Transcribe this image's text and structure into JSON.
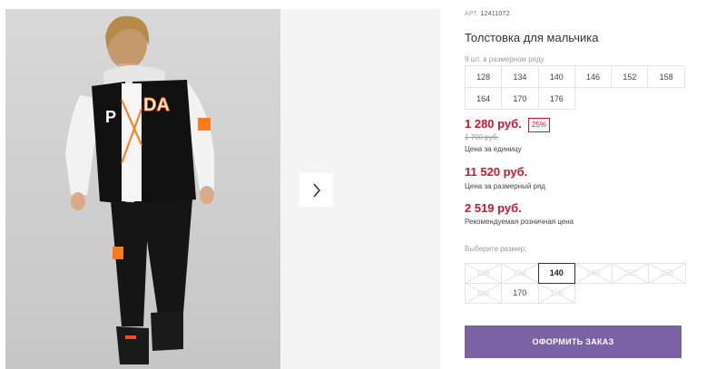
{
  "product": {
    "sku_label": "АРТ.",
    "sku_value": "12411072",
    "title": "Толстовка для мальчика",
    "size_row_label": "9 шт. в размерном ряду",
    "size_row": [
      "128",
      "134",
      "140",
      "146",
      "152",
      "158",
      "164",
      "170",
      "176"
    ]
  },
  "prices": {
    "unit_price": "1 280 руб.",
    "discount": "25%",
    "old_price": "1 700 руб.",
    "unit_label": "Цена за единицу",
    "row_price": "11 520 руб.",
    "row_label": "Цена за размерный ряд",
    "retail_price": "2 519 руб.",
    "retail_label": "Рекомендуемая розничная цена"
  },
  "size_picker": {
    "label": "Выберите размер:",
    "sizes": [
      {
        "value": "128",
        "state": "disabled"
      },
      {
        "value": "134",
        "state": "disabled"
      },
      {
        "value": "140",
        "state": "selected"
      },
      {
        "value": "146",
        "state": "disabled"
      },
      {
        "value": "152",
        "state": "disabled"
      },
      {
        "value": "158",
        "state": "disabled"
      },
      {
        "value": "164",
        "state": "disabled"
      },
      {
        "value": "170",
        "state": "available"
      },
      {
        "value": "176",
        "state": "disabled"
      }
    ]
  },
  "actions": {
    "order_label": "ОФОРМИТЬ ЗАКАЗ"
  },
  "gallery": {
    "next_icon": "chevron-right-icon"
  },
  "colors": {
    "price_red": "#d0142e",
    "button_purple": "#7b62a5"
  }
}
